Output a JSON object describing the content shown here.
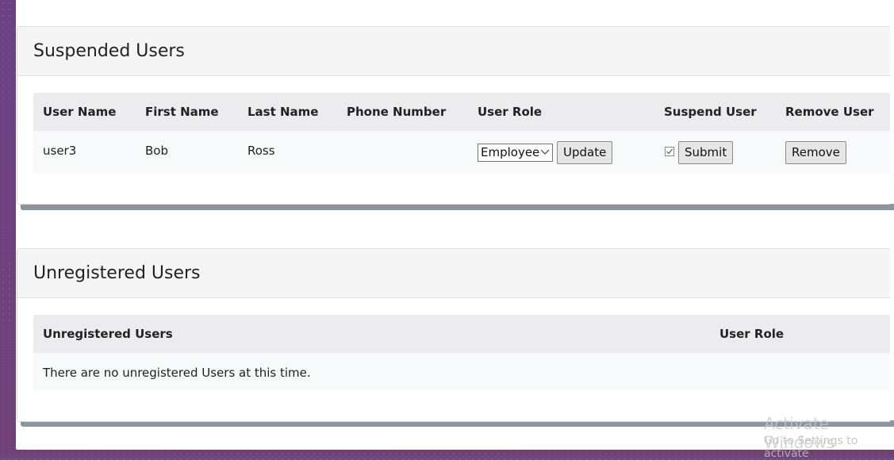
{
  "suspended": {
    "title": "Suspended Users",
    "headers": [
      "User Name",
      "First Name",
      "Last Name",
      "Phone Number",
      "User Role",
      "Suspend User",
      "Remove User"
    ],
    "rows": [
      {
        "user_name": "user3",
        "first_name": "Bob",
        "last_name": "Ross",
        "phone": "",
        "role": "Employee",
        "update_label": "Update",
        "suspend_checked": true,
        "submit_label": "Submit",
        "remove_label": "Remove"
      }
    ]
  },
  "unregistered": {
    "title": "Unregistered Users",
    "headers": [
      "Unregistered Users",
      "User Role"
    ],
    "empty_message": "There are no unregistered Users at this time."
  },
  "watermark": {
    "line1": "Activate Windows",
    "line2": "Go to Settings to activate"
  }
}
